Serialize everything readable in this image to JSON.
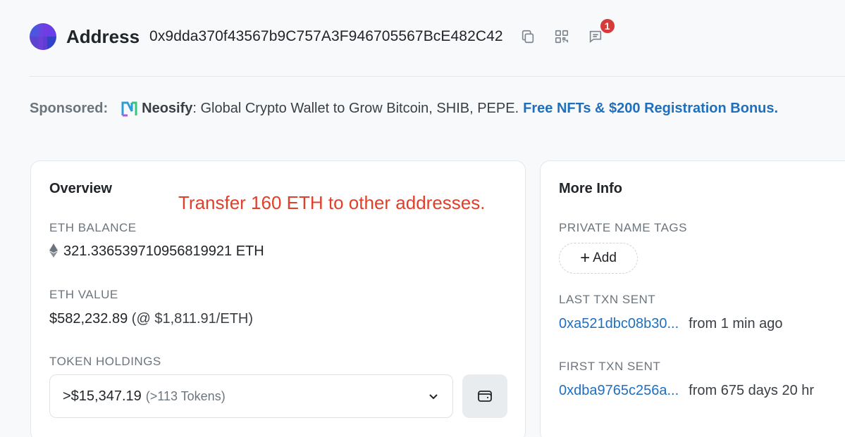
{
  "header": {
    "title": "Address",
    "address": "0x9dda370f43567b9C757A3F946705567BcE482C42",
    "notification_count": "1"
  },
  "sponsored": {
    "label": "Sponsored:",
    "sponsor_name": "Neosify",
    "text": ": Global Crypto Wallet to Grow Bitcoin, SHIB, PEPE.",
    "link_text": "Free NFTs & $200 Registration Bonus."
  },
  "overview": {
    "title": "Overview",
    "annotation": "Transfer 160 ETH to other addresses.",
    "eth_balance_label": "ETH BALANCE",
    "eth_balance_value": "321.336539710956819921 ETH",
    "eth_value_label": "ETH VALUE",
    "eth_value_amount": "$582,232.89",
    "eth_value_rate": "(@ $1,811.91/ETH)",
    "token_holdings_label": "TOKEN HOLDINGS",
    "token_holdings_value": ">$15,347.19",
    "token_holdings_count": "(>113 Tokens)"
  },
  "more_info": {
    "title": "More Info",
    "private_tags_label": "PRIVATE NAME TAGS",
    "add_label": "Add",
    "last_txn_label": "LAST TXN SENT",
    "last_txn_hash": "0xa521dbc08b30...",
    "last_txn_age": "from 1 min ago",
    "first_txn_label": "FIRST TXN SENT",
    "first_txn_hash": "0xdba9765c256a...",
    "first_txn_age": "from 675 days 20 hr"
  },
  "icons": {
    "copy": "copy-icon",
    "qr": "qr-code-icon",
    "comment": "comment-icon",
    "eth": "ethereum-icon",
    "chevron": "chevron-down-icon",
    "wallet": "wallet-icon"
  },
  "colors": {
    "link": "#1f6fbf",
    "annotation": "#e0402a",
    "badge": "#d73a3a"
  }
}
